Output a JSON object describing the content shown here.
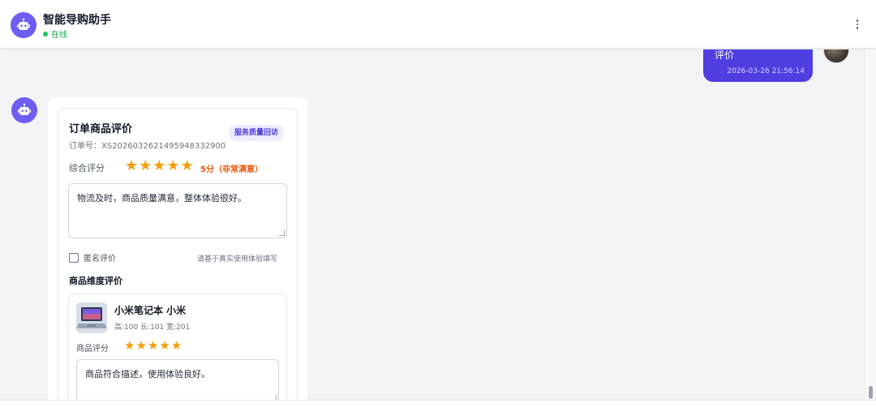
{
  "header": {
    "title": "智能导购助手",
    "status": "在线"
  },
  "user_message": {
    "text": "评价",
    "time": "2026-03-26 21:56:14"
  },
  "review_card": {
    "title": "订单商品评价",
    "badge": "服务质量回访",
    "order_no": "订单号：XS20260326214959483329​00",
    "overall_label": "综合评分",
    "overall_rating": 5,
    "score_text": "5分（非常满意）",
    "review_text": "物流及时，商品质量满意，整体体验很好。",
    "anonymous_label": "匿名评价",
    "hint": "请基于真实使用体验填写",
    "section_title": "商品维度评价",
    "product": {
      "name": "小米笔记本 小米",
      "spec": "高:100 长:101 宽:201",
      "score_label": "商品评分",
      "rating": 5,
      "review_text": "商品符合描述，使用体验良好。"
    }
  },
  "colors": {
    "accent": "#4f3ee0",
    "bot_avatar": "#6d5df0",
    "star": "#f59e0b",
    "online": "#22c55e"
  },
  "icons": {
    "bot": "robot-icon",
    "more": "more-vertical-icon",
    "star": "star-icon"
  }
}
